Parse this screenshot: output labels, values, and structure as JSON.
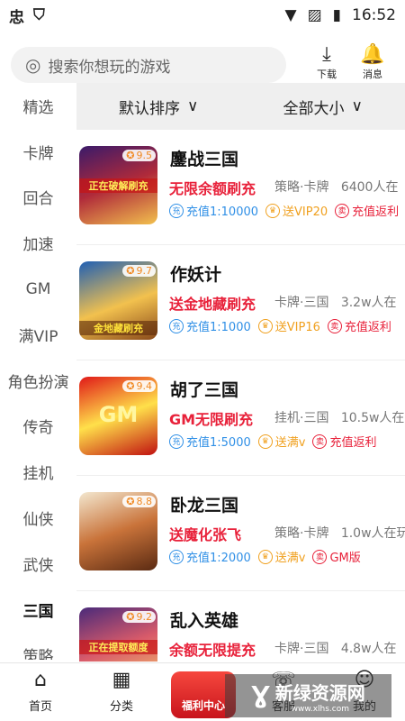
{
  "status_bar": {
    "time": "16:52",
    "app_glyph": "忠"
  },
  "search": {
    "placeholder": "搜索你想玩的游戏"
  },
  "top_actions": {
    "download_label": "下载",
    "message_label": "消息"
  },
  "sidebar": {
    "items": [
      "精选",
      "卡牌",
      "回合",
      "加速",
      "GM",
      "满VIP",
      "角色扮演",
      "传奇",
      "挂机",
      "仙侠",
      "武侠",
      "三国",
      "策略"
    ],
    "active": "三国"
  },
  "sort": {
    "default_label": "默认排序",
    "size_label": "全部大小"
  },
  "games": [
    {
      "title": "鏖战三国",
      "rating": "9.5",
      "promo": "无限余额刷充",
      "meta": "策略·卡牌",
      "players": "6400人在",
      "tag1": "充值1:10000",
      "tag2": "送VIP20",
      "tag3": "充值返利",
      "thumb_text": "正在破解刷充"
    },
    {
      "title": "作妖计",
      "rating": "9.7",
      "promo": "送金地藏刷充",
      "meta": "卡牌·三国",
      "players": "3.2w人在",
      "tag1": "充值1:1000",
      "tag2": "送VIP16",
      "tag3": "充值返利",
      "thumb_text": "金地藏刷充"
    },
    {
      "title": "胡了三国",
      "rating": "9.4",
      "promo": "GM无限刷充",
      "meta": "挂机·三国",
      "players": "10.5w人在",
      "tag1": "充值1:5000",
      "tag2": "送满v",
      "tag3": "充值返利",
      "thumb_text": "GM"
    },
    {
      "title": "卧龙三国",
      "rating": "8.8",
      "promo": "送魔化张飞",
      "meta": "策略·卡牌",
      "players": "1.0w人在玩",
      "tag1": "充值1:2000",
      "tag2": "送满v",
      "tag3": "GM版",
      "thumb_text": ""
    },
    {
      "title": "乱入英雄",
      "rating": "9.2",
      "promo": "余额无限提充",
      "meta": "卡牌·三国",
      "players": "4.8w人在",
      "tag1": "",
      "tag2": "",
      "tag3": "",
      "thumb_text": "正在提取额度"
    }
  ],
  "bottom_nav": {
    "home": "首页",
    "category": "分类",
    "welfare": "福利中心",
    "service": "客服",
    "mine": "我的"
  },
  "watermark": {
    "text": "新绿资源网",
    "url": "www.xlhs.com"
  },
  "colors": {
    "promo": "#e8213a",
    "tag_blue": "#2f8fe6",
    "tag_orange": "#f0a01e",
    "rating": "#f08a24"
  }
}
